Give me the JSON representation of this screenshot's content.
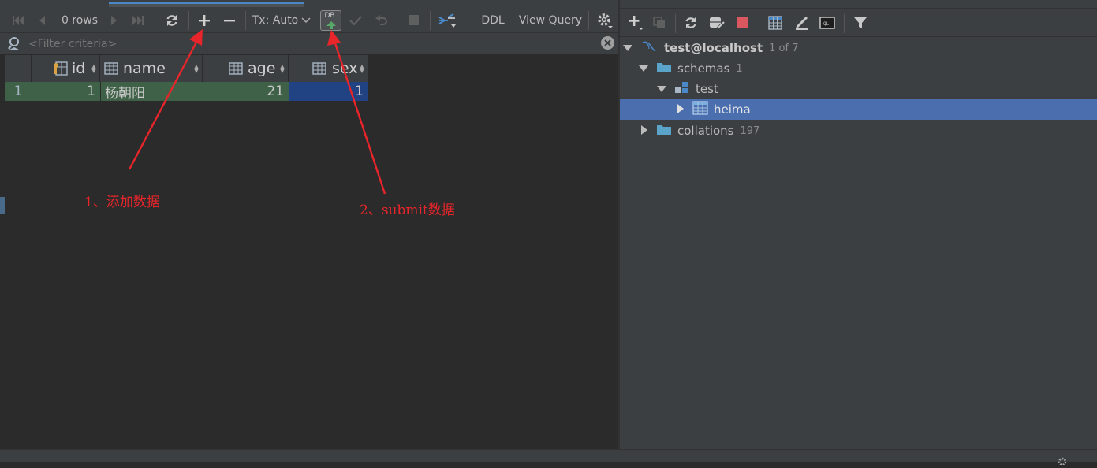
{
  "toolbar": {
    "rows_label": "0 rows",
    "tx_label": "Tx: Auto",
    "db_badge": "DB",
    "ddl_label": "DDL",
    "view_query_label": "View Query"
  },
  "filter": {
    "placeholder": "<Filter criteria>"
  },
  "grid": {
    "columns": [
      "id",
      "name",
      "age",
      "sex"
    ],
    "rows": [
      {
        "row_number": "1",
        "id": "1",
        "name": "杨朝阳",
        "age": "21",
        "sex": "1"
      }
    ]
  },
  "tree": {
    "connection": {
      "label": "test@localhost",
      "count": "1 of 7"
    },
    "schemas": {
      "label": "schemas",
      "count": "1"
    },
    "schema": {
      "label": "test"
    },
    "table": {
      "label": "heima"
    },
    "collations": {
      "label": "collations",
      "count": "197"
    }
  },
  "annotations": {
    "add": "1、添加数据",
    "submit": "2、submit数据"
  },
  "colors": {
    "accent": "#4a88c7",
    "selection": "#4b6eaf",
    "annotation": "#e8252a",
    "row_green": "#3f6147",
    "cell_blue": "#214283"
  }
}
